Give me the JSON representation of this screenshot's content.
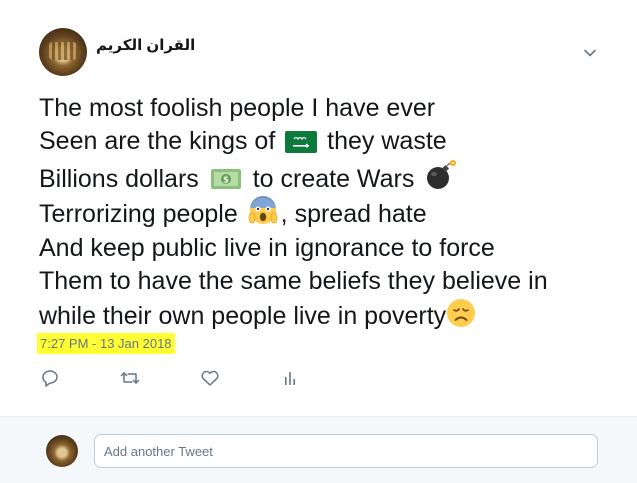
{
  "tweet": {
    "author": {
      "display_name": "القران الكريم"
    },
    "text_lines": [
      "The most foolish people I have ever",
      [
        "Seen are the kings of ",
        "they waste"
      ],
      [
        "Billions dollars ",
        "to create Wars"
      ],
      [
        "Terrorizing people ",
        ", spread hate"
      ],
      "And keep public live in ignorance to force",
      "Them to have the same beliefs they believe in",
      "while their own people live in poverty"
    ],
    "emojis": [
      "saudi-arabia-flag-icon",
      "dollar-banknote-icon",
      "bomb-icon",
      "face-screaming-icon",
      "disappointed-face-icon"
    ],
    "timestamp": "7:27 PM - 13 Jan 2018",
    "highlight_color": "#ffff33",
    "actions": [
      "reply-icon",
      "retweet-icon",
      "like-icon",
      "analytics-icon"
    ]
  },
  "reply": {
    "placeholder": "Add another Tweet"
  }
}
